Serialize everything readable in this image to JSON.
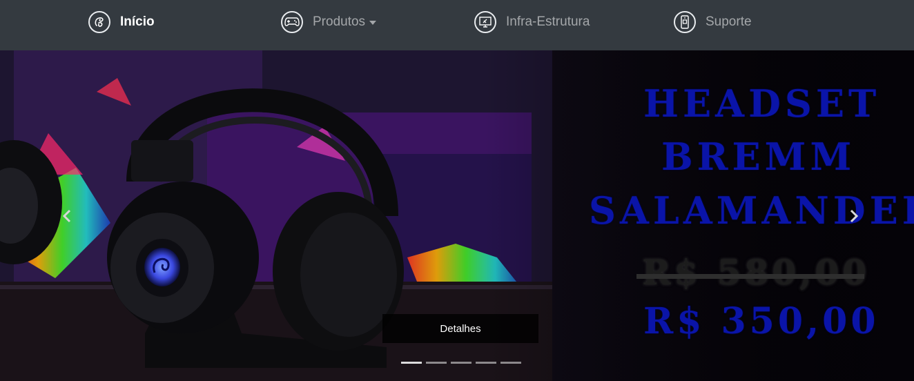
{
  "navbar": {
    "items": [
      {
        "label": "Início",
        "icon": "brand-logo-icon",
        "active": true
      },
      {
        "label": "Produtos",
        "icon": "gamepad-icon",
        "dropdown": true
      },
      {
        "label": "Infra-Estrutura",
        "icon": "monitor-tools-icon"
      },
      {
        "label": "Suporte",
        "icon": "phone-support-icon"
      }
    ]
  },
  "carousel": {
    "slide": {
      "title_lines": [
        "HEADSET",
        "BREMM",
        "SALAMANDER"
      ],
      "old_price": "R$ 580,00",
      "new_price": "R$ 350,00",
      "button_label": "Detalhes"
    },
    "indicator_count": 5,
    "active_indicator": 0
  },
  "colors": {
    "navbar_bg": "#343a40",
    "promo_text": "#0a14a8",
    "headset_glow": "#4a5cff"
  }
}
